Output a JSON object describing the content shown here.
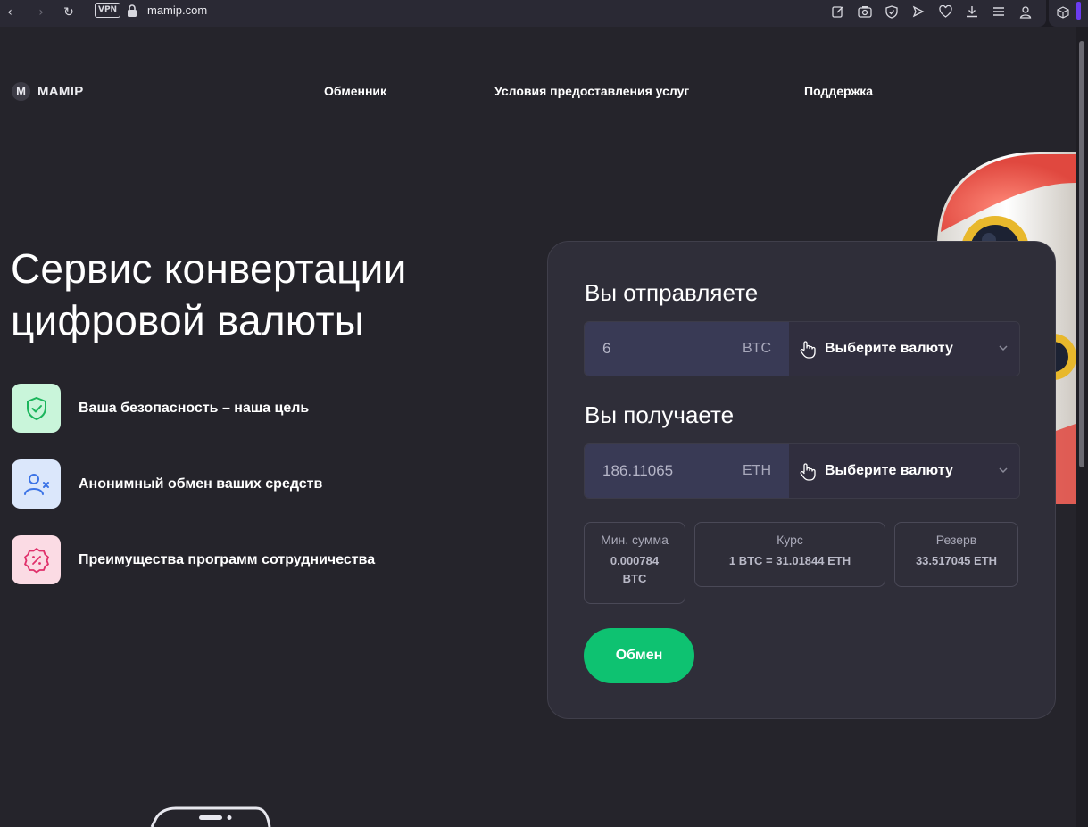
{
  "browser": {
    "vpn_label": "VPN",
    "url": "mamip.com"
  },
  "header": {
    "logo_mark": "M",
    "logo_text": "MAMIP",
    "nav": [
      "Обменник",
      "Условия предоставления услуг",
      "Поддержка"
    ]
  },
  "hero": {
    "title_line1": "Сервис конвертации",
    "title_line2": "цифровой валюты",
    "features": [
      {
        "text": "Ваша безопасность – наша цель",
        "icon": "shield-check-icon",
        "color": "#c9f5da"
      },
      {
        "text": "Анонимный обмен ваших средств",
        "icon": "user-x-icon",
        "color": "#dbe7fb"
      },
      {
        "text": "Преимущества программ сотрудничества",
        "icon": "discount-badge-icon",
        "color": "#fbdbe4"
      }
    ]
  },
  "exchange": {
    "send_label": "Вы отправляете",
    "send_amount": "6",
    "send_currency": "BTC",
    "send_select": "Выберите валюту",
    "receive_label": "Вы получаете",
    "receive_amount": "186.11065",
    "receive_currency": "ETH",
    "receive_select": "Выберите валюту",
    "min_title": "Мин. сумма",
    "min_value_line1": "0.000784",
    "min_value_line2": "BTC",
    "rate_title": "Курс",
    "rate_value": "1 BTC = 31.01844 ETH",
    "reserve_title": "Резерв",
    "reserve_value": "33.517045 ETH",
    "button_label": "Обмен",
    "accent_color": "#0ec271"
  }
}
